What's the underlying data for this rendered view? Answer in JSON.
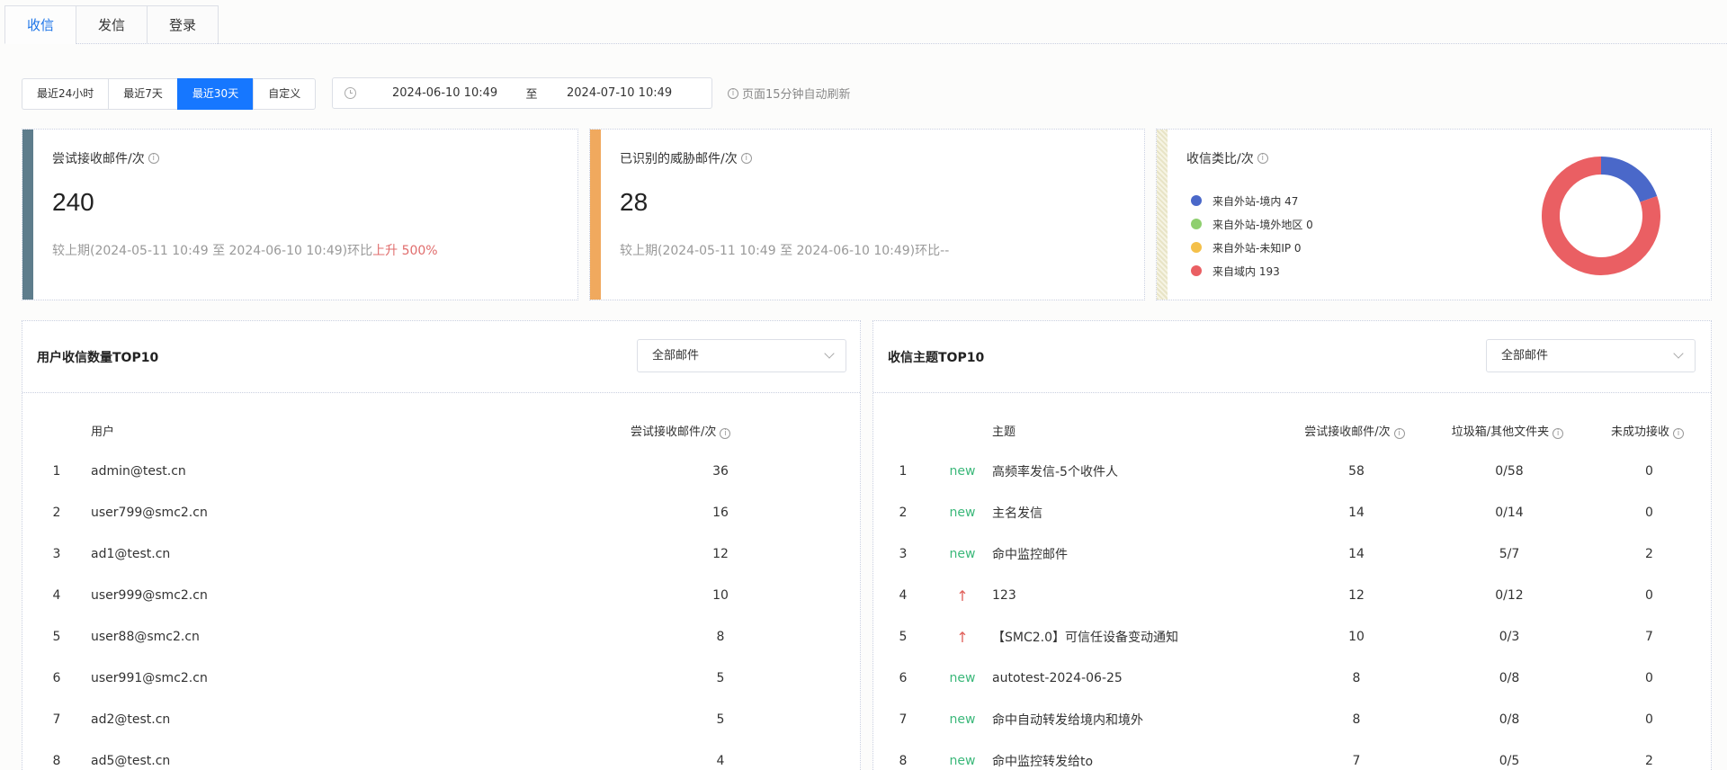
{
  "tabs": [
    "收信",
    "发信",
    "登录"
  ],
  "range": {
    "buttons": [
      "最近24小时",
      "最近7天",
      "最近30天",
      "自定义"
    ],
    "active_index": 2,
    "start": "2024-06-10 10:49",
    "sep": "至",
    "end": "2024-07-10 10:49",
    "refresh_note": "页面15分钟自动刷新"
  },
  "cards": {
    "received": {
      "title": "尝试接收邮件/次",
      "value": "240",
      "compare_prefix": "较上期(2024-05-11 10:49 至 2024-06-10 10:49)环比",
      "compare_trend": "上升 500%",
      "bar_color": "#5e7d8c"
    },
    "threat": {
      "title": "已识别的威胁邮件/次",
      "value": "28",
      "compare_prefix": "较上期(2024-05-11 10:49 至 2024-06-10 10:49)环比",
      "compare_trend": "--",
      "bar_color": "#f0a95e"
    },
    "ratio": {
      "title": "收信类比/次",
      "legend": [
        {
          "label": "来自外站-境内 47",
          "value": 47,
          "color": "#4a68c9"
        },
        {
          "label": "来自外站-境外地区 0",
          "value": 0,
          "color": "#8fcf6f"
        },
        {
          "label": "来自外站-未知IP 0",
          "value": 0,
          "color": "#f4c04a"
        },
        {
          "label": "来自域内 193",
          "value": 193,
          "color": "#ea5f63"
        }
      ]
    }
  },
  "user_top": {
    "title": "用户收信数量TOP10",
    "select": "全部邮件",
    "headers": [
      "用户",
      "尝试接收邮件/次"
    ],
    "rows": [
      [
        "1",
        "admin@test.cn",
        "36"
      ],
      [
        "2",
        "user799@smc2.cn",
        "16"
      ],
      [
        "3",
        "ad1@test.cn",
        "12"
      ],
      [
        "4",
        "user999@smc2.cn",
        "10"
      ],
      [
        "5",
        "user88@smc2.cn",
        "8"
      ],
      [
        "6",
        "user991@smc2.cn",
        "5"
      ],
      [
        "7",
        "ad2@test.cn",
        "5"
      ],
      [
        "8",
        "ad5@test.cn",
        "4"
      ]
    ]
  },
  "subject_top": {
    "title": "收信主题TOP10",
    "select": "全部邮件",
    "headers": [
      "主题",
      "尝试接收邮件/次",
      "垃圾箱/其他文件夹",
      "未成功接收"
    ],
    "rows": [
      [
        "1",
        "new",
        "高频率发信-5个收件人",
        "58",
        "0/58",
        "0"
      ],
      [
        "2",
        "new",
        "主名发信",
        "14",
        "0/14",
        "0"
      ],
      [
        "3",
        "new",
        "命中监控邮件",
        "14",
        "5/7",
        "2"
      ],
      [
        "4",
        "↑",
        "123",
        "12",
        "0/12",
        "0"
      ],
      [
        "5",
        "↑",
        "【SMC2.0】可信任设备变动通知",
        "10",
        "0/3",
        "7"
      ],
      [
        "6",
        "new",
        "autotest-2024-06-25",
        "8",
        "0/8",
        "0"
      ],
      [
        "7",
        "new",
        "命中自动转发给境内和境外",
        "8",
        "0/8",
        "0"
      ],
      [
        "8",
        "new",
        "命中监控转发给to",
        "7",
        "0/5",
        "2"
      ]
    ]
  }
}
